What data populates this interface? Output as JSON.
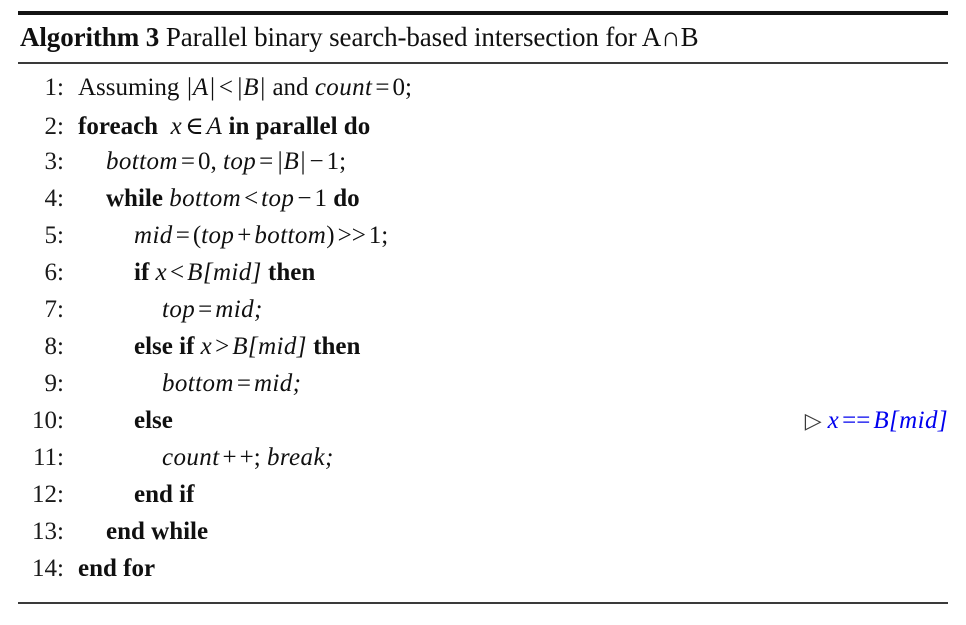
{
  "caption": {
    "label": "Algorithm",
    "number": "3",
    "title": "Parallel binary search-based intersection for A∩B"
  },
  "accent_color": "#0000ee",
  "rule_color": "#141414",
  "lines": [
    {
      "number": "1:",
      "indent": 0,
      "text": "Assuming |A| < |B| and count = 0;",
      "parts": {
        "p1": "Assuming",
        "p2": "|A|",
        "p3": "<",
        "p4": "|B|",
        "p5": "and",
        "p6": "count",
        "p7": "=",
        "p8": "0;"
      }
    },
    {
      "number": "2:",
      "indent": 0,
      "text": "foreach x ∈ A in parallel do",
      "parts": {
        "p1": "foreach",
        "p2": "x",
        "p3": "∈",
        "p4": "A",
        "p5": "in parallel do"
      }
    },
    {
      "number": "3:",
      "indent": 1,
      "text": "bottom = 0, top = |B| − 1;",
      "parts": {
        "p1": "bottom",
        "p2": "=",
        "p3": "0,",
        "p4": "top",
        "p5": "=",
        "p6": "|B|",
        "p7": "−",
        "p8": "1;"
      }
    },
    {
      "number": "4:",
      "indent": 1,
      "text": "while bottom < top − 1 do",
      "parts": {
        "p1": "while",
        "p2": "bottom",
        "p3": "<",
        "p4": "top",
        "p5": "−",
        "p6": "1",
        "p7": "do"
      }
    },
    {
      "number": "5:",
      "indent": 2,
      "text": "mid = (top + bottom) >> 1;",
      "parts": {
        "p1": "mid",
        "p2": "=",
        "p3": "(",
        "p4": "top",
        "p5": "+",
        "p6": "bottom",
        "p7": ")",
        "p8": ">>",
        "p9": "1;"
      }
    },
    {
      "number": "6:",
      "indent": 2,
      "text": "if x < B[mid] then",
      "parts": {
        "p1": "if",
        "p2": "x",
        "p3": "<",
        "p4": "B",
        "p5": "[",
        "p6": "mid",
        "p7": "]",
        "p8": "then"
      }
    },
    {
      "number": "7:",
      "indent": 3,
      "text": "top = mid;",
      "parts": {
        "p1": "top",
        "p2": "=",
        "p3": "mid;"
      }
    },
    {
      "number": "8:",
      "indent": 2,
      "text": "else if x > B[mid] then",
      "parts": {
        "p1": "else if",
        "p2": "x",
        "p3": ">",
        "p4": "B",
        "p5": "[",
        "p6": "mid",
        "p7": "]",
        "p8": "then"
      }
    },
    {
      "number": "9:",
      "indent": 3,
      "text": "bottom = mid;",
      "parts": {
        "p1": "bottom",
        "p2": "=",
        "p3": "mid;"
      }
    },
    {
      "number": "10:",
      "indent": 2,
      "text": "else",
      "parts": {
        "p1": "else"
      },
      "comment": {
        "marker": "▷",
        "p1": "x",
        "p2": "==",
        "p3": "B",
        "p4": "[",
        "p5": "mid",
        "p6": "]",
        "text": "x == B[mid]"
      }
    },
    {
      "number": "11:",
      "indent": 3,
      "text": "count + +; break;",
      "parts": {
        "p1": "count",
        "p2": "+",
        "p3": "+;",
        "p4": "break;"
      }
    },
    {
      "number": "12:",
      "indent": 2,
      "text": "end if",
      "parts": {
        "p1": "end if"
      }
    },
    {
      "number": "13:",
      "indent": 1,
      "text": "end while",
      "parts": {
        "p1": "end while"
      }
    },
    {
      "number": "14:",
      "indent": 0,
      "text": "end for",
      "parts": {
        "p1": "end for"
      }
    }
  ]
}
